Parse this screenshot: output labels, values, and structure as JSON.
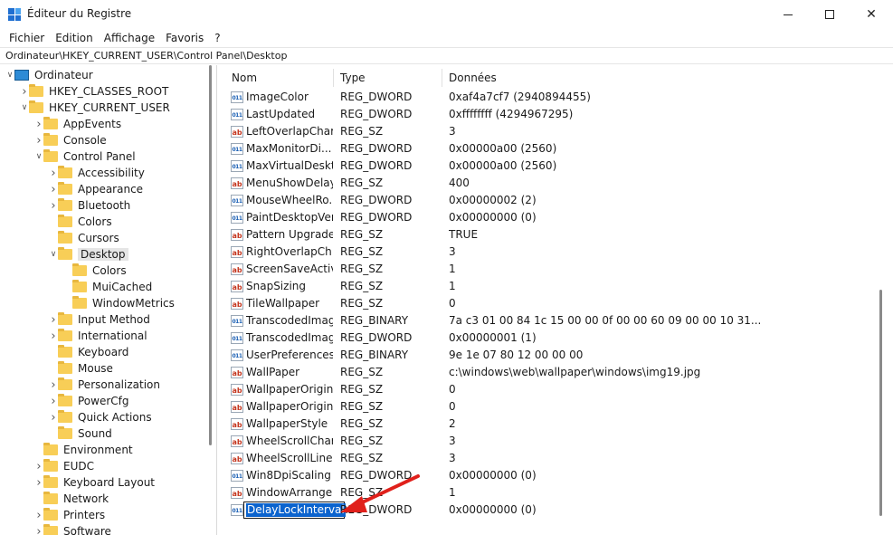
{
  "window": {
    "title": "Éditeur du Registre",
    "minimize_icon": "minimize-icon",
    "maximize_icon": "maximize-icon",
    "close_glyph": "✕"
  },
  "menu": [
    "Fichier",
    "Edition",
    "Affichage",
    "Favoris",
    "?"
  ],
  "address": "Ordinateur\\HKEY_CURRENT_USER\\Control Panel\\Desktop",
  "tree": [
    {
      "label": "Ordinateur",
      "level": 0,
      "chev": "down",
      "icon": "computer-icon"
    },
    {
      "label": "HKEY_CLASSES_ROOT",
      "level": 1,
      "chev": "right",
      "icon": "folder-icon"
    },
    {
      "label": "HKEY_CURRENT_USER",
      "level": 1,
      "chev": "down",
      "icon": "folder-icon"
    },
    {
      "label": "AppEvents",
      "level": 2,
      "chev": "right",
      "icon": "folder-icon"
    },
    {
      "label": "Console",
      "level": 2,
      "chev": "right",
      "icon": "folder-icon"
    },
    {
      "label": "Control Panel",
      "level": 2,
      "chev": "down",
      "icon": "folder-icon"
    },
    {
      "label": "Accessibility",
      "level": 3,
      "chev": "right",
      "icon": "folder-icon"
    },
    {
      "label": "Appearance",
      "level": 3,
      "chev": "right",
      "icon": "folder-icon"
    },
    {
      "label": "Bluetooth",
      "level": 3,
      "chev": "right",
      "icon": "folder-icon"
    },
    {
      "label": "Colors",
      "level": 3,
      "chev": "",
      "icon": "folder-icon"
    },
    {
      "label": "Cursors",
      "level": 3,
      "chev": "",
      "icon": "folder-icon"
    },
    {
      "label": "Desktop",
      "level": 3,
      "chev": "down",
      "icon": "folder-open-icon",
      "selected": true
    },
    {
      "label": "Colors",
      "level": 4,
      "chev": "",
      "icon": "folder-icon"
    },
    {
      "label": "MuiCached",
      "level": 4,
      "chev": "",
      "icon": "folder-icon"
    },
    {
      "label": "WindowMetrics",
      "level": 4,
      "chev": "",
      "icon": "folder-icon"
    },
    {
      "label": "Input Method",
      "level": 3,
      "chev": "right",
      "icon": "folder-icon"
    },
    {
      "label": "International",
      "level": 3,
      "chev": "right",
      "icon": "folder-icon"
    },
    {
      "label": "Keyboard",
      "level": 3,
      "chev": "",
      "icon": "folder-icon"
    },
    {
      "label": "Mouse",
      "level": 3,
      "chev": "",
      "icon": "folder-icon"
    },
    {
      "label": "Personalization",
      "level": 3,
      "chev": "right",
      "icon": "folder-icon"
    },
    {
      "label": "PowerCfg",
      "level": 3,
      "chev": "right",
      "icon": "folder-icon"
    },
    {
      "label": "Quick Actions",
      "level": 3,
      "chev": "right",
      "icon": "folder-icon"
    },
    {
      "label": "Sound",
      "level": 3,
      "chev": "",
      "icon": "folder-icon"
    },
    {
      "label": "Environment",
      "level": 2,
      "chev": "",
      "icon": "folder-icon"
    },
    {
      "label": "EUDC",
      "level": 2,
      "chev": "right",
      "icon": "folder-icon"
    },
    {
      "label": "Keyboard Layout",
      "level": 2,
      "chev": "right",
      "icon": "folder-icon"
    },
    {
      "label": "Network",
      "level": 2,
      "chev": "",
      "icon": "folder-icon"
    },
    {
      "label": "Printers",
      "level": 2,
      "chev": "right",
      "icon": "folder-icon"
    },
    {
      "label": "Software",
      "level": 2,
      "chev": "right",
      "icon": "folder-icon"
    }
  ],
  "columns": {
    "name": "Nom",
    "type": "Type",
    "data": "Données"
  },
  "values": [
    {
      "name": "ImageColor",
      "type": "REG_DWORD",
      "data": "0xaf4a7cf7 (2940894455)",
      "icon": "bin"
    },
    {
      "name": "LastUpdated",
      "type": "REG_DWORD",
      "data": "0xffffffff (4294967295)",
      "icon": "bin"
    },
    {
      "name": "LeftOverlapChars",
      "type": "REG_SZ",
      "data": "3",
      "icon": "ab"
    },
    {
      "name": "MaxMonitorDi...",
      "type": "REG_DWORD",
      "data": "0x00000a00 (2560)",
      "icon": "bin"
    },
    {
      "name": "MaxVirtualDeskt...",
      "type": "REG_DWORD",
      "data": "0x00000a00 (2560)",
      "icon": "bin"
    },
    {
      "name": "MenuShowDelay",
      "type": "REG_SZ",
      "data": "400",
      "icon": "ab"
    },
    {
      "name": "MouseWheelRo...",
      "type": "REG_DWORD",
      "data": "0x00000002 (2)",
      "icon": "bin"
    },
    {
      "name": "PaintDesktopVer...",
      "type": "REG_DWORD",
      "data": "0x00000000 (0)",
      "icon": "bin"
    },
    {
      "name": "Pattern Upgrade",
      "type": "REG_SZ",
      "data": "TRUE",
      "icon": "ab"
    },
    {
      "name": "RightOverlapCh...",
      "type": "REG_SZ",
      "data": "3",
      "icon": "ab"
    },
    {
      "name": "ScreenSaveActive",
      "type": "REG_SZ",
      "data": "1",
      "icon": "ab"
    },
    {
      "name": "SnapSizing",
      "type": "REG_SZ",
      "data": "1",
      "icon": "ab"
    },
    {
      "name": "TileWallpaper",
      "type": "REG_SZ",
      "data": "0",
      "icon": "ab"
    },
    {
      "name": "TranscodedImag...",
      "type": "REG_BINARY",
      "data": "7a c3 01 00 84 1c 15 00 00 0f 00 00 60 09 00 00 10 31...",
      "icon": "bin"
    },
    {
      "name": "TranscodedImag...",
      "type": "REG_DWORD",
      "data": "0x00000001 (1)",
      "icon": "bin"
    },
    {
      "name": "UserPreferences...",
      "type": "REG_BINARY",
      "data": "9e 1e 07 80 12 00 00 00",
      "icon": "bin"
    },
    {
      "name": "WallPaper",
      "type": "REG_SZ",
      "data": "c:\\windows\\web\\wallpaper\\windows\\img19.jpg",
      "icon": "ab"
    },
    {
      "name": "WallpaperOriginX",
      "type": "REG_SZ",
      "data": "0",
      "icon": "ab"
    },
    {
      "name": "WallpaperOriginY",
      "type": "REG_SZ",
      "data": "0",
      "icon": "ab"
    },
    {
      "name": "WallpaperStyle",
      "type": "REG_SZ",
      "data": "2",
      "icon": "ab"
    },
    {
      "name": "WheelScrollChars",
      "type": "REG_SZ",
      "data": "3",
      "icon": "ab"
    },
    {
      "name": "WheelScrollLines",
      "type": "REG_SZ",
      "data": "3",
      "icon": "ab"
    },
    {
      "name": "Win8DpiScaling",
      "type": "REG_DWORD",
      "data": "0x00000000 (0)",
      "icon": "bin"
    },
    {
      "name": "WindowArrange...",
      "type": "REG_SZ",
      "data": "1",
      "icon": "ab"
    },
    {
      "name": "DelayLockInterval",
      "type": "REG_DWORD",
      "data": "0x00000000 (0)",
      "icon": "bin",
      "editing": true
    }
  ],
  "annotation": {
    "arrow_color": "#e0201b",
    "icon": "red-arrow-icon"
  },
  "colors": {
    "selection": "#0b63ce",
    "folder": "#f8ce57"
  }
}
